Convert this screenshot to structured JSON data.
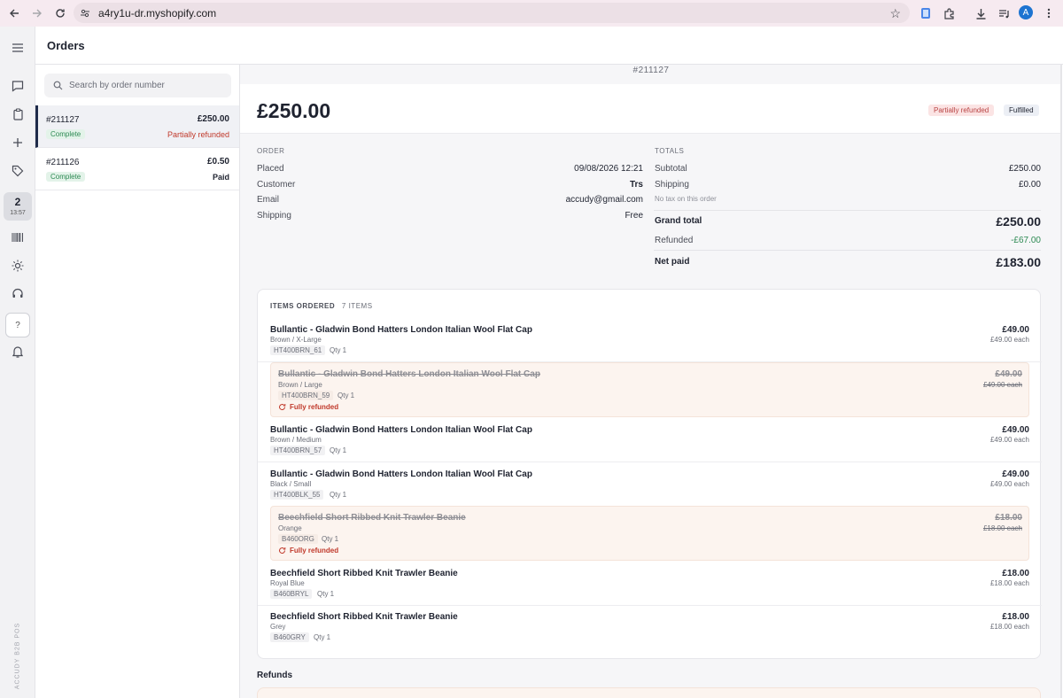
{
  "browser": {
    "url": "a4ry1u-dr.myshopify.com",
    "avatar_letter": "A"
  },
  "rail": {
    "badge_count": "2",
    "badge_time": "13:57",
    "help_label": "?",
    "brand_vertical": "ACCUDY B2B POS"
  },
  "page": {
    "title": "Orders"
  },
  "search": {
    "placeholder": "Search by order number"
  },
  "orders": [
    {
      "number": "#211127",
      "amount": "£250.00",
      "status": "Complete",
      "payment": "Partially refunded",
      "payment_color": "#c0392b"
    },
    {
      "number": "#211126",
      "amount": "£0.50",
      "status": "Complete",
      "payment": "Paid",
      "payment_color": "#1f2330"
    }
  ],
  "detail": {
    "order_number": "#211127",
    "total": "£250.00",
    "badges": {
      "refund": "Partially refunded",
      "fulfillment": "Fulfilled"
    },
    "order_section": {
      "label": "ORDER",
      "rows": [
        {
          "key": "Placed",
          "value": "09/08/2026 12:21"
        },
        {
          "key": "Customer",
          "value": "Trs"
        },
        {
          "key": "Email",
          "value": "accudy@gmail.com"
        },
        {
          "key": "Shipping",
          "value": "Free"
        }
      ]
    },
    "totals_section": {
      "label": "TOTALS",
      "subtotal_label": "Subtotal",
      "subtotal": "£250.00",
      "shipping_label": "Shipping",
      "shipping": "£0.00",
      "tax_note": "No tax on this order",
      "grand_total_label": "Grand total",
      "grand_total": "£250.00",
      "refunded_label": "Refunded",
      "refunded": "-£67.00",
      "net_paid_label": "Net paid",
      "net_paid": "£183.00",
      "refunded_color": "#2d8a53"
    },
    "items_section": {
      "title": "ITEMS ORDERED",
      "count": "7 ITEMS",
      "items": [
        {
          "name": "Bullantic - Gladwin Bond Hatters London Italian Wool Flat Cap",
          "variant": "Brown / X-Large",
          "sku": "HT400BRN_61",
          "qty": "Qty 1",
          "price": "£49.00",
          "each": "£49.00 each",
          "refunded": false
        },
        {
          "name": "Bullantic - Gladwin Bond Hatters London Italian Wool Flat Cap",
          "variant": "Brown / Large",
          "sku": "HT400BRN_59",
          "qty": "Qty 1",
          "price": "£49.00",
          "each": "£49.00 each",
          "refunded": true,
          "refund_label": "Fully refunded"
        },
        {
          "name": "Bullantic - Gladwin Bond Hatters London Italian Wool Flat Cap",
          "variant": "Brown / Medium",
          "sku": "HT400BRN_57",
          "qty": "Qty 1",
          "price": "£49.00",
          "each": "£49.00 each",
          "refunded": false
        },
        {
          "name": "Bullantic - Gladwin Bond Hatters London Italian Wool Flat Cap",
          "variant": "Black / Small",
          "sku": "HT400BLK_55",
          "qty": "Qty 1",
          "price": "£49.00",
          "each": "£49.00 each",
          "refunded": false
        },
        {
          "name": "Beechfield Short Ribbed Knit Trawler Beanie",
          "variant": "Orange",
          "sku": "B460ORG",
          "qty": "Qty 1",
          "price": "£18.00",
          "each": "£18.00 each",
          "refunded": true,
          "refund_label": "Fully refunded"
        },
        {
          "name": "Beechfield Short Ribbed Knit Trawler Beanie",
          "variant": "Royal Blue",
          "sku": "B460BRYL",
          "qty": "Qty 1",
          "price": "£18.00",
          "each": "£18.00 each",
          "refunded": false
        },
        {
          "name": "Beechfield Short Ribbed Knit Trawler Beanie",
          "variant": "Grey",
          "sku": "B460GRY",
          "qty": "Qty 1",
          "price": "£18.00",
          "each": "£18.00 each",
          "refunded": false
        }
      ]
    },
    "refunds_title": "Refunds"
  },
  "icons": {
    "back": "arrow-left-icon",
    "forward": "arrow-right-icon",
    "reload": "reload-icon",
    "star": "star-icon",
    "menu": "hamburger-icon",
    "chat": "chat-icon",
    "clipboard": "clipboard-icon",
    "plus": "plus-icon",
    "tag": "tag-icon",
    "barcode": "barcode-icon",
    "sun": "sun-icon",
    "headset": "headset-icon",
    "bell": "bell-icon"
  }
}
